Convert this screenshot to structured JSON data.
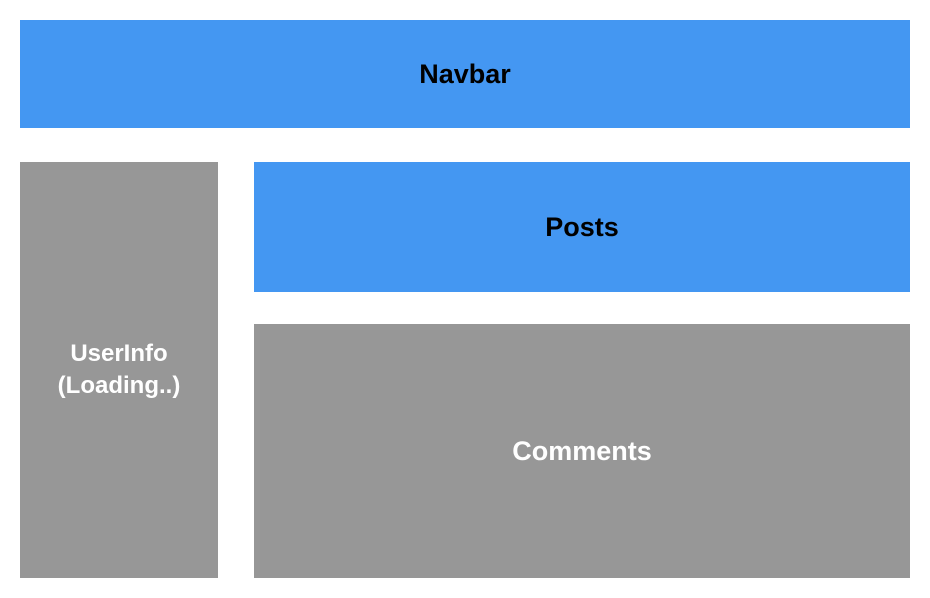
{
  "navbar": {
    "label": "Navbar"
  },
  "userinfo": {
    "label": "UserInfo\n(Loading..)"
  },
  "posts": {
    "label": "Posts"
  },
  "comments": {
    "label": "Comments"
  },
  "colors": {
    "blue": "#4497f2",
    "gray": "#979797"
  }
}
